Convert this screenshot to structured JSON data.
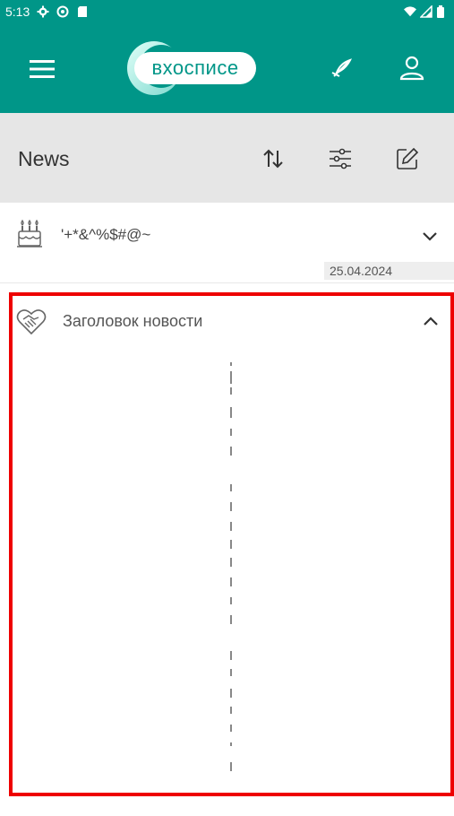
{
  "status_bar": {
    "time": "5:13",
    "left_icons": [
      "settings-icon",
      "location-icon",
      "sd-card-icon"
    ],
    "right_icons": [
      "wifi-icon",
      "signal-icon",
      "battery-icon"
    ]
  },
  "app_bar": {
    "brand": "вхосписе",
    "brand_color": "#009688",
    "actions": [
      "menu-icon",
      "feather-icon",
      "profile-icon"
    ]
  },
  "toolbar": {
    "title": "News",
    "actions": [
      "sort-icon",
      "filter-icon",
      "edit-icon"
    ]
  },
  "news": [
    {
      "title": "'+*&^%$#@~",
      "date": "25.04.2024",
      "icon": "birthday-cake-icon",
      "expanded": false
    },
    {
      "title": "Заголовок новости",
      "icon": "heart-handshake-icon",
      "expanded": true
    }
  ],
  "colors": {
    "primary": "#009688",
    "toolbar_bg": "#e6e6e6",
    "highlight_border": "#ee0000"
  }
}
